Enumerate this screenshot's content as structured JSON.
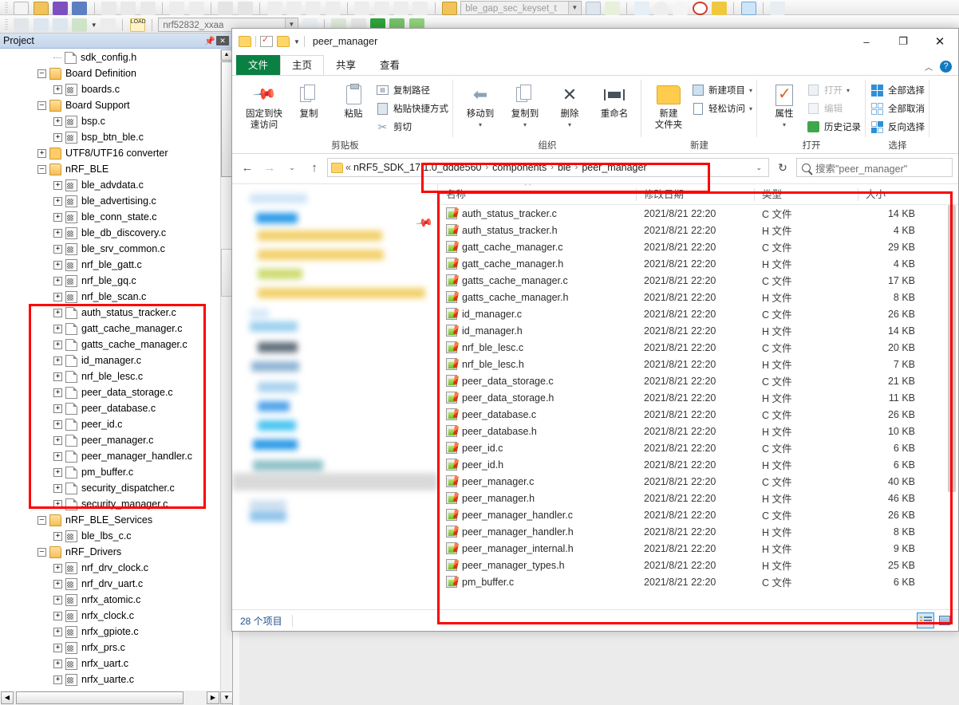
{
  "ide": {
    "toolbar": {
      "device_value": "nrf52832_xxaa",
      "symbol_value": "ble_gap_sec_keyset_t",
      "load_label": "LOAD"
    },
    "project_panel": {
      "title": "Project",
      "pin_icon": "pin-icon",
      "close_icon": "close-icon",
      "tree": [
        {
          "label": "sdk_config.h",
          "depth": 2,
          "icon": "doc",
          "expander": "none"
        },
        {
          "label": "Board Definition",
          "depth": 1,
          "icon": "folder-open",
          "expander": "minus"
        },
        {
          "label": "boards.c",
          "depth": 2,
          "icon": "csrc",
          "expander": "plus"
        },
        {
          "label": "Board Support",
          "depth": 1,
          "icon": "folder-open",
          "expander": "minus"
        },
        {
          "label": "bsp.c",
          "depth": 2,
          "icon": "csrc",
          "expander": "plus"
        },
        {
          "label": "bsp_btn_ble.c",
          "depth": 2,
          "icon": "csrc",
          "expander": "plus"
        },
        {
          "label": "UTF8/UTF16 converter",
          "depth": 1,
          "icon": "folder",
          "expander": "plus"
        },
        {
          "label": "nRF_BLE",
          "depth": 1,
          "icon": "folder-open",
          "expander": "minus"
        },
        {
          "label": "ble_advdata.c",
          "depth": 2,
          "icon": "csrc",
          "expander": "plus"
        },
        {
          "label": "ble_advertising.c",
          "depth": 2,
          "icon": "csrc",
          "expander": "plus"
        },
        {
          "label": "ble_conn_state.c",
          "depth": 2,
          "icon": "csrc",
          "expander": "plus"
        },
        {
          "label": "ble_db_discovery.c",
          "depth": 2,
          "icon": "csrc",
          "expander": "plus"
        },
        {
          "label": "ble_srv_common.c",
          "depth": 2,
          "icon": "csrc",
          "expander": "plus"
        },
        {
          "label": "nrf_ble_gatt.c",
          "depth": 2,
          "icon": "csrc",
          "expander": "plus"
        },
        {
          "label": "nrf_ble_gq.c",
          "depth": 2,
          "icon": "csrc",
          "expander": "plus"
        },
        {
          "label": "nrf_ble_scan.c",
          "depth": 2,
          "icon": "csrc",
          "expander": "plus"
        },
        {
          "label": "auth_status_tracker.c",
          "depth": 2,
          "icon": "doc",
          "expander": "plus"
        },
        {
          "label": "gatt_cache_manager.c",
          "depth": 2,
          "icon": "doc",
          "expander": "plus"
        },
        {
          "label": "gatts_cache_manager.c",
          "depth": 2,
          "icon": "doc",
          "expander": "plus"
        },
        {
          "label": "id_manager.c",
          "depth": 2,
          "icon": "doc",
          "expander": "plus"
        },
        {
          "label": "nrf_ble_lesc.c",
          "depth": 2,
          "icon": "doc",
          "expander": "plus"
        },
        {
          "label": "peer_data_storage.c",
          "depth": 2,
          "icon": "doc",
          "expander": "plus"
        },
        {
          "label": "peer_database.c",
          "depth": 2,
          "icon": "doc",
          "expander": "plus"
        },
        {
          "label": "peer_id.c",
          "depth": 2,
          "icon": "doc",
          "expander": "plus"
        },
        {
          "label": "peer_manager.c",
          "depth": 2,
          "icon": "doc",
          "expander": "plus"
        },
        {
          "label": "peer_manager_handler.c",
          "depth": 2,
          "icon": "doc",
          "expander": "plus"
        },
        {
          "label": "pm_buffer.c",
          "depth": 2,
          "icon": "doc",
          "expander": "plus"
        },
        {
          "label": "security_dispatcher.c",
          "depth": 2,
          "icon": "doc",
          "expander": "plus"
        },
        {
          "label": "security_manager.c",
          "depth": 2,
          "icon": "doc",
          "expander": "plus"
        },
        {
          "label": "nRF_BLE_Services",
          "depth": 1,
          "icon": "folder-open",
          "expander": "minus"
        },
        {
          "label": "ble_lbs_c.c",
          "depth": 2,
          "icon": "csrc",
          "expander": "plus"
        },
        {
          "label": "nRF_Drivers",
          "depth": 1,
          "icon": "folder-open",
          "expander": "minus"
        },
        {
          "label": "nrf_drv_clock.c",
          "depth": 2,
          "icon": "csrc",
          "expander": "plus"
        },
        {
          "label": "nrf_drv_uart.c",
          "depth": 2,
          "icon": "csrc",
          "expander": "plus"
        },
        {
          "label": "nrfx_atomic.c",
          "depth": 2,
          "icon": "csrc",
          "expander": "plus"
        },
        {
          "label": "nrfx_clock.c",
          "depth": 2,
          "icon": "csrc",
          "expander": "plus"
        },
        {
          "label": "nrfx_gpiote.c",
          "depth": 2,
          "icon": "csrc",
          "expander": "plus"
        },
        {
          "label": "nrfx_prs.c",
          "depth": 2,
          "icon": "csrc",
          "expander": "plus"
        },
        {
          "label": "nrfx_uart.c",
          "depth": 2,
          "icon": "csrc",
          "expander": "plus"
        },
        {
          "label": "nrfx_uarte.c",
          "depth": 2,
          "icon": "csrc",
          "expander": "plus"
        }
      ]
    }
  },
  "explorer": {
    "window_title": "peer_manager",
    "quick_access": [
      "folder-icon",
      "properties-icon",
      "folder-icon",
      "dropdown-caret-icon"
    ],
    "window_buttons": {
      "minimize": "–",
      "maximize": "❐",
      "close": "✕"
    },
    "ribbon_tabs": [
      {
        "label": "文件",
        "state": "file"
      },
      {
        "label": "主页",
        "state": "active"
      },
      {
        "label": "共享",
        "state": "normal"
      },
      {
        "label": "查看",
        "state": "normal"
      }
    ],
    "ribbon_groups": [
      {
        "label": "剪贴板",
        "big": [
          {
            "label": "固定到快\n速访问",
            "icon": "pin-icon"
          },
          {
            "label": "复制",
            "icon": "copy-icon"
          },
          {
            "label": "粘贴",
            "icon": "paste-icon"
          }
        ],
        "small": [
          {
            "label": "复制路径",
            "icon": "copy-path-icon",
            "disabled": false
          },
          {
            "label": "粘贴快捷方式",
            "icon": "paste-shortcut-icon",
            "disabled": false
          },
          {
            "label": "剪切",
            "icon": "cut-icon",
            "disabled": false
          }
        ]
      },
      {
        "label": "组织",
        "big": [
          {
            "label": "移动到",
            "icon": "move-to-icon",
            "caret": true
          },
          {
            "label": "复制到",
            "icon": "copy-to-icon",
            "caret": true
          },
          {
            "label": "删除",
            "icon": "delete-icon",
            "caret": true
          },
          {
            "label": "重命名",
            "icon": "rename-icon"
          }
        ],
        "small": []
      },
      {
        "label": "新建",
        "big": [
          {
            "label": "新建\n文件夹",
            "icon": "new-folder-icon"
          }
        ],
        "small": [
          {
            "label": "新建项目",
            "icon": "new-item-icon",
            "caret": true
          },
          {
            "label": "轻松访问",
            "icon": "easy-access-icon",
            "caret": true
          }
        ]
      },
      {
        "label": "打开",
        "big": [
          {
            "label": "属性",
            "icon": "properties-icon",
            "caret": true
          }
        ],
        "small": [
          {
            "label": "打开",
            "icon": "open-icon",
            "caret": true,
            "disabled": true
          },
          {
            "label": "编辑",
            "icon": "edit-icon",
            "disabled": true
          },
          {
            "label": "历史记录",
            "icon": "history-icon",
            "disabled": false
          }
        ]
      },
      {
        "label": "选择",
        "big": [],
        "small": [
          {
            "label": "全部选择",
            "icon": "select-all-icon"
          },
          {
            "label": "全部取消",
            "icon": "select-none-icon"
          },
          {
            "label": "反向选择",
            "icon": "invert-selection-icon"
          }
        ]
      }
    ],
    "address_bar": {
      "back_icon": "back-arrow-icon",
      "forward_icon": "forward-arrow-icon",
      "recent_icon": "recent-caret-icon",
      "up_icon": "up-arrow-icon",
      "crumb_prefix": "«",
      "breadcrumbs": [
        "nRF5_SDK_17.1.0_ddde560",
        "components",
        "ble",
        "peer_manager"
      ],
      "refresh_icon": "refresh-icon",
      "search_placeholder": "搜索\"peer_manager\""
    },
    "columns": [
      {
        "key": "name",
        "label": "名称"
      },
      {
        "key": "date",
        "label": "修改日期"
      },
      {
        "key": "type",
        "label": "类型"
      },
      {
        "key": "size",
        "label": "大小"
      }
    ],
    "files": [
      {
        "name": "auth_status_tracker.c",
        "date": "2021/8/21 22:20",
        "type": "C 文件",
        "size": "14 KB"
      },
      {
        "name": "auth_status_tracker.h",
        "date": "2021/8/21 22:20",
        "type": "H 文件",
        "size": "4 KB"
      },
      {
        "name": "gatt_cache_manager.c",
        "date": "2021/8/21 22:20",
        "type": "C 文件",
        "size": "29 KB"
      },
      {
        "name": "gatt_cache_manager.h",
        "date": "2021/8/21 22:20",
        "type": "H 文件",
        "size": "4 KB"
      },
      {
        "name": "gatts_cache_manager.c",
        "date": "2021/8/21 22:20",
        "type": "C 文件",
        "size": "17 KB"
      },
      {
        "name": "gatts_cache_manager.h",
        "date": "2021/8/21 22:20",
        "type": "H 文件",
        "size": "8 KB"
      },
      {
        "name": "id_manager.c",
        "date": "2021/8/21 22:20",
        "type": "C 文件",
        "size": "26 KB"
      },
      {
        "name": "id_manager.h",
        "date": "2021/8/21 22:20",
        "type": "H 文件",
        "size": "14 KB"
      },
      {
        "name": "nrf_ble_lesc.c",
        "date": "2021/8/21 22:20",
        "type": "C 文件",
        "size": "20 KB"
      },
      {
        "name": "nrf_ble_lesc.h",
        "date": "2021/8/21 22:20",
        "type": "H 文件",
        "size": "7 KB"
      },
      {
        "name": "peer_data_storage.c",
        "date": "2021/8/21 22:20",
        "type": "C 文件",
        "size": "21 KB"
      },
      {
        "name": "peer_data_storage.h",
        "date": "2021/8/21 22:20",
        "type": "H 文件",
        "size": "11 KB"
      },
      {
        "name": "peer_database.c",
        "date": "2021/8/21 22:20",
        "type": "C 文件",
        "size": "26 KB"
      },
      {
        "name": "peer_database.h",
        "date": "2021/8/21 22:20",
        "type": "H 文件",
        "size": "10 KB"
      },
      {
        "name": "peer_id.c",
        "date": "2021/8/21 22:20",
        "type": "C 文件",
        "size": "6 KB"
      },
      {
        "name": "peer_id.h",
        "date": "2021/8/21 22:20",
        "type": "H 文件",
        "size": "6 KB"
      },
      {
        "name": "peer_manager.c",
        "date": "2021/8/21 22:20",
        "type": "C 文件",
        "size": "40 KB"
      },
      {
        "name": "peer_manager.h",
        "date": "2021/8/21 22:20",
        "type": "H 文件",
        "size": "46 KB"
      },
      {
        "name": "peer_manager_handler.c",
        "date": "2021/8/21 22:20",
        "type": "C 文件",
        "size": "26 KB"
      },
      {
        "name": "peer_manager_handler.h",
        "date": "2021/8/21 22:20",
        "type": "H 文件",
        "size": "8 KB"
      },
      {
        "name": "peer_manager_internal.h",
        "date": "2021/8/21 22:20",
        "type": "H 文件",
        "size": "9 KB"
      },
      {
        "name": "peer_manager_types.h",
        "date": "2021/8/21 22:20",
        "type": "H 文件",
        "size": "25 KB"
      },
      {
        "name": "pm_buffer.c",
        "date": "2021/8/21 22:20",
        "type": "C 文件",
        "size": "6 KB"
      }
    ],
    "status": {
      "item_count": "28 个项目",
      "view_details_icon": "details-view-icon",
      "view_large_icon": "large-icons-view-icon"
    }
  }
}
